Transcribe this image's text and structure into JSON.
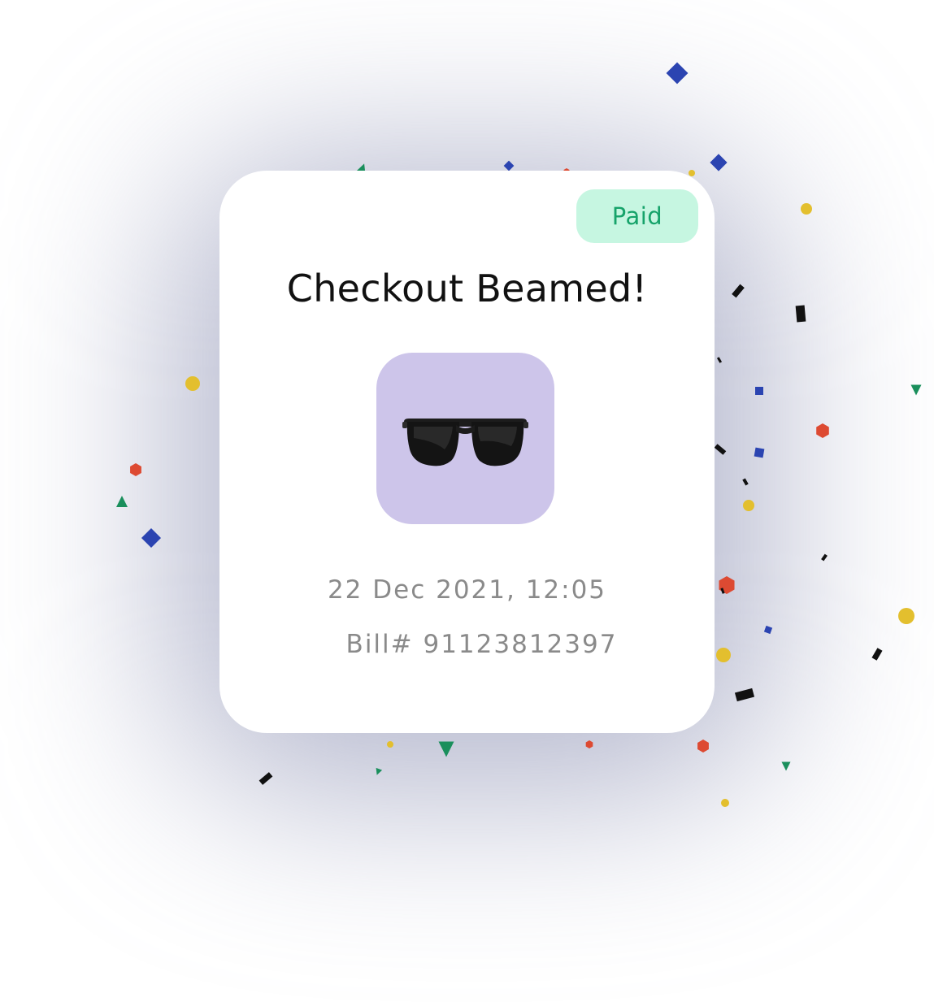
{
  "card": {
    "status": "Paid",
    "title": "Checkout Beamed!",
    "product_icon": "sunglasses-icon",
    "date": "22 Dec 2021, 12:05",
    "bill": "Bill# 91123812397"
  },
  "colors": {
    "badge_bg": "#c6f6e1",
    "badge_text": "#16a36a",
    "tile_bg": "#cdc5ea",
    "confetti_blue": "#2b44b1",
    "confetti_green": "#1a8f5c",
    "confetti_red": "#dd4a32",
    "confetti_yellow": "#e3bf2e",
    "confetti_black": "#111111"
  }
}
